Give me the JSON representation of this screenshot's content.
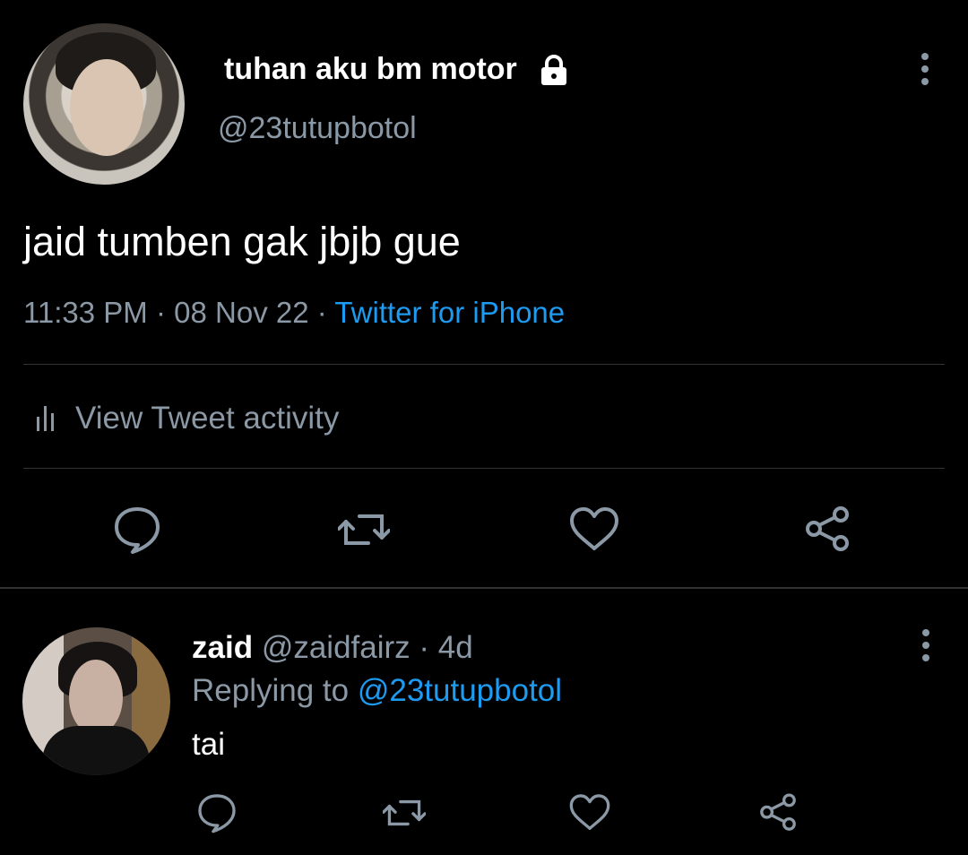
{
  "tweet": {
    "display_name": "tuhan aku bm motor",
    "handle": "@23tutupbotol",
    "text": "jaid tumben gak jbjb gue",
    "time": "11:33 PM",
    "date": "08 Nov 22",
    "source": "Twitter for iPhone",
    "separator": "·",
    "activity_label": "View Tweet activity"
  },
  "reply": {
    "display_name": "zaid",
    "handle": "@zaidfairz",
    "age": "4d",
    "separator": "·",
    "replying_label": "Replying to",
    "replying_to": "@23tutupbotol",
    "text": "tai"
  },
  "icons": {
    "lock": "lock-icon",
    "more": "more-vertical-icon",
    "activity": "bar-chart-icon",
    "reply": "reply-icon",
    "retweet": "retweet-icon",
    "like": "heart-icon",
    "share": "share-icon"
  },
  "colors": {
    "background": "#000000",
    "text": "#e7e9ea",
    "muted": "#8b98a5",
    "link": "#1d9bf0",
    "divider": "#2f3336"
  }
}
